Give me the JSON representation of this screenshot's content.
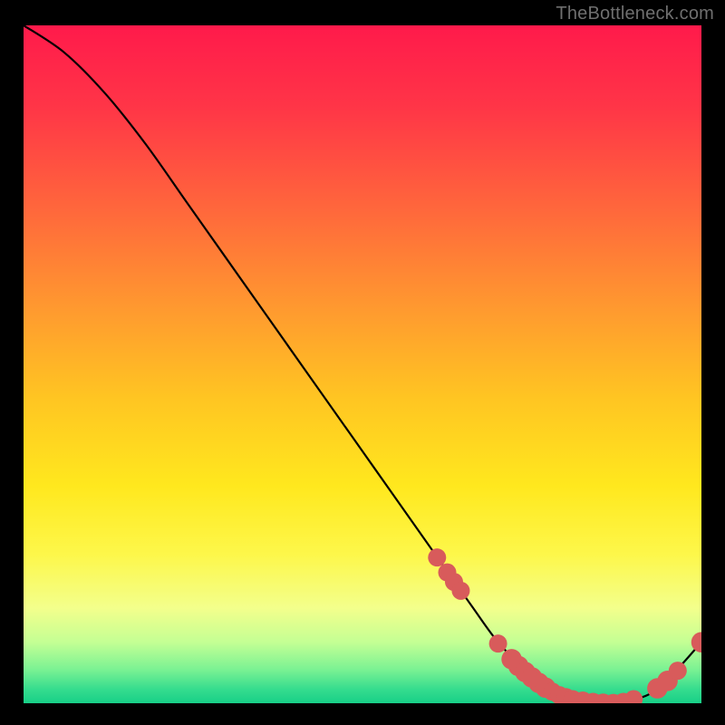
{
  "watermark": "TheBottleneck.com",
  "chart_data": {
    "type": "line",
    "title": "",
    "xlabel": "",
    "ylabel": "",
    "xlim": [
      0,
      100
    ],
    "ylim": [
      0,
      100
    ],
    "grid": false,
    "legend": false,
    "series": [
      {
        "name": "curve",
        "x": [
          0,
          6,
          12,
          18,
          24,
          30,
          36,
          42,
          48,
          54,
          60,
          66,
          70,
          74,
          78,
          82,
          86,
          90,
          94,
          100
        ],
        "y": [
          100,
          96,
          90,
          82.5,
          74,
          65.5,
          57,
          48.5,
          40,
          31.5,
          23,
          14.5,
          9,
          5,
          2,
          0.5,
          0,
          0.5,
          2.5,
          9
        ]
      }
    ],
    "markers": {
      "name": "highlighted-points",
      "color": "#d85b5b",
      "points": [
        {
          "x": 61,
          "y": 21.5,
          "r": 1.1
        },
        {
          "x": 62.5,
          "y": 19.3,
          "r": 1.1
        },
        {
          "x": 63.5,
          "y": 17.9,
          "r": 1.1
        },
        {
          "x": 64.5,
          "y": 16.6,
          "r": 1.1
        },
        {
          "x": 70,
          "y": 8.8,
          "r": 1.1
        },
        {
          "x": 72,
          "y": 6.5,
          "r": 1.3
        },
        {
          "x": 73,
          "y": 5.5,
          "r": 1.3
        },
        {
          "x": 74,
          "y": 4.6,
          "r": 1.3
        },
        {
          "x": 75,
          "y": 3.8,
          "r": 1.3
        },
        {
          "x": 76,
          "y": 3.0,
          "r": 1.3
        },
        {
          "x": 77,
          "y": 2.3,
          "r": 1.3
        },
        {
          "x": 78,
          "y": 1.7,
          "r": 1.1
        },
        {
          "x": 79,
          "y": 1.2,
          "r": 1.1
        },
        {
          "x": 80,
          "y": 0.9,
          "r": 1.1
        },
        {
          "x": 81,
          "y": 0.6,
          "r": 1.1
        },
        {
          "x": 82.5,
          "y": 0.4,
          "r": 1.1
        },
        {
          "x": 84,
          "y": 0.2,
          "r": 1.1
        },
        {
          "x": 85.5,
          "y": 0.1,
          "r": 1.1
        },
        {
          "x": 87,
          "y": 0.05,
          "r": 1.1
        },
        {
          "x": 88.5,
          "y": 0.2,
          "r": 1.1
        },
        {
          "x": 90,
          "y": 0.6,
          "r": 1.1
        },
        {
          "x": 93.5,
          "y": 2.2,
          "r": 1.3
        },
        {
          "x": 95,
          "y": 3.3,
          "r": 1.3
        },
        {
          "x": 96.5,
          "y": 4.8,
          "r": 1.1
        },
        {
          "x": 100,
          "y": 9.0,
          "r": 1.3
        }
      ]
    },
    "background_gradient": {
      "stops": [
        {
          "offset": 0.0,
          "color": "#ff1a4b"
        },
        {
          "offset": 0.12,
          "color": "#ff3547"
        },
        {
          "offset": 0.28,
          "color": "#ff6a3b"
        },
        {
          "offset": 0.42,
          "color": "#ff9a2f"
        },
        {
          "offset": 0.55,
          "color": "#ffc522"
        },
        {
          "offset": 0.68,
          "color": "#ffe81e"
        },
        {
          "offset": 0.78,
          "color": "#fdf74a"
        },
        {
          "offset": 0.86,
          "color": "#f3ff8c"
        },
        {
          "offset": 0.91,
          "color": "#c4ff94"
        },
        {
          "offset": 0.95,
          "color": "#7bf293"
        },
        {
          "offset": 0.98,
          "color": "#34dc8e"
        },
        {
          "offset": 1.0,
          "color": "#18cf87"
        }
      ]
    }
  }
}
